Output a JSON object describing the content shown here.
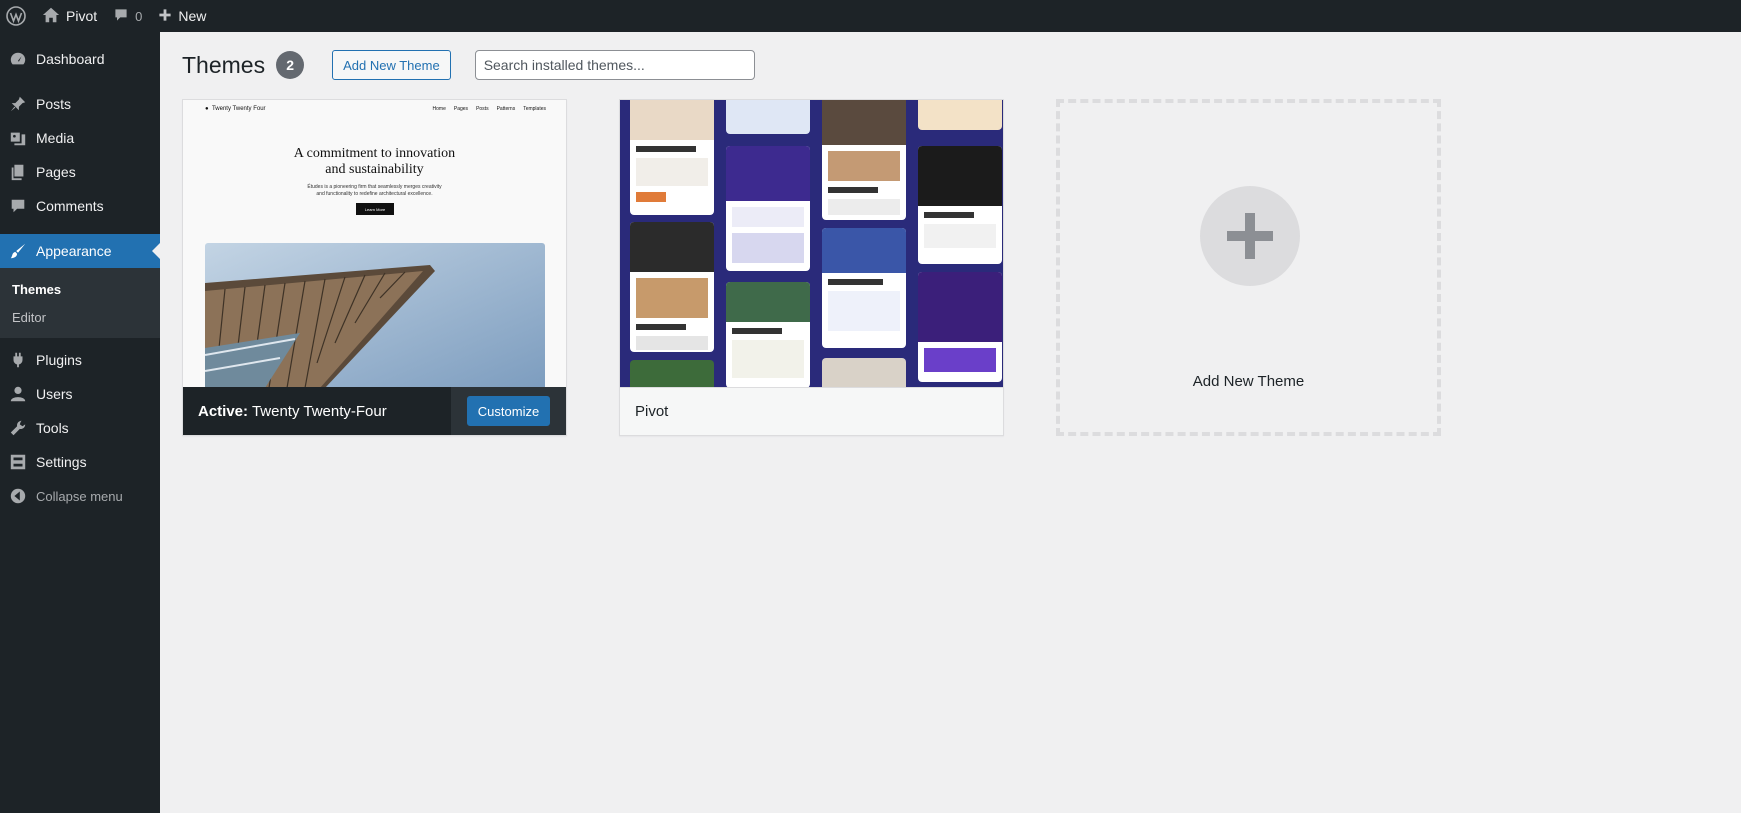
{
  "adminbar": {
    "site_name": "Pivot",
    "comments_count": "0",
    "new_label": "New"
  },
  "sidebar": {
    "items": [
      {
        "label": "Dashboard",
        "icon": "dashboard-icon"
      },
      {
        "label": "Posts",
        "icon": "pin-icon"
      },
      {
        "label": "Media",
        "icon": "media-icon"
      },
      {
        "label": "Pages",
        "icon": "pages-icon"
      },
      {
        "label": "Comments",
        "icon": "comment-icon"
      },
      {
        "label": "Appearance",
        "icon": "brush-icon",
        "current": true
      },
      {
        "label": "Plugins",
        "icon": "plugin-icon"
      },
      {
        "label": "Users",
        "icon": "user-icon"
      },
      {
        "label": "Tools",
        "icon": "wrench-icon"
      },
      {
        "label": "Settings",
        "icon": "settings-icon"
      }
    ],
    "submenu": [
      {
        "label": "Themes",
        "active": true
      },
      {
        "label": "Editor"
      }
    ],
    "collapse_label": "Collapse menu"
  },
  "page": {
    "title": "Themes",
    "count": "2",
    "add_new_button": "Add New Theme",
    "search_placeholder": "Search installed themes..."
  },
  "themes": [
    {
      "active_prefix": "Active:",
      "name": "Twenty Twenty-Four",
      "customize_label": "Customize",
      "preview": {
        "brand": "Twenty Twenty Four",
        "nav": [
          "Home",
          "Pages",
          "Posts",
          "Patterns",
          "Templates"
        ],
        "headline_1": "A commitment to innovation",
        "headline_2": "and sustainability",
        "lede_1": "Études is a pioneering firm that seamlessly merges creativity",
        "lede_2": "and functionality to redefine architectural excellence.",
        "cta": "Learn More"
      }
    },
    {
      "name": "Pivot"
    }
  ],
  "add_new_card": {
    "label": "Add New Theme"
  },
  "colors": {
    "admin_dark": "#1d2327",
    "accent": "#2271b1",
    "background": "#f0f0f1"
  }
}
